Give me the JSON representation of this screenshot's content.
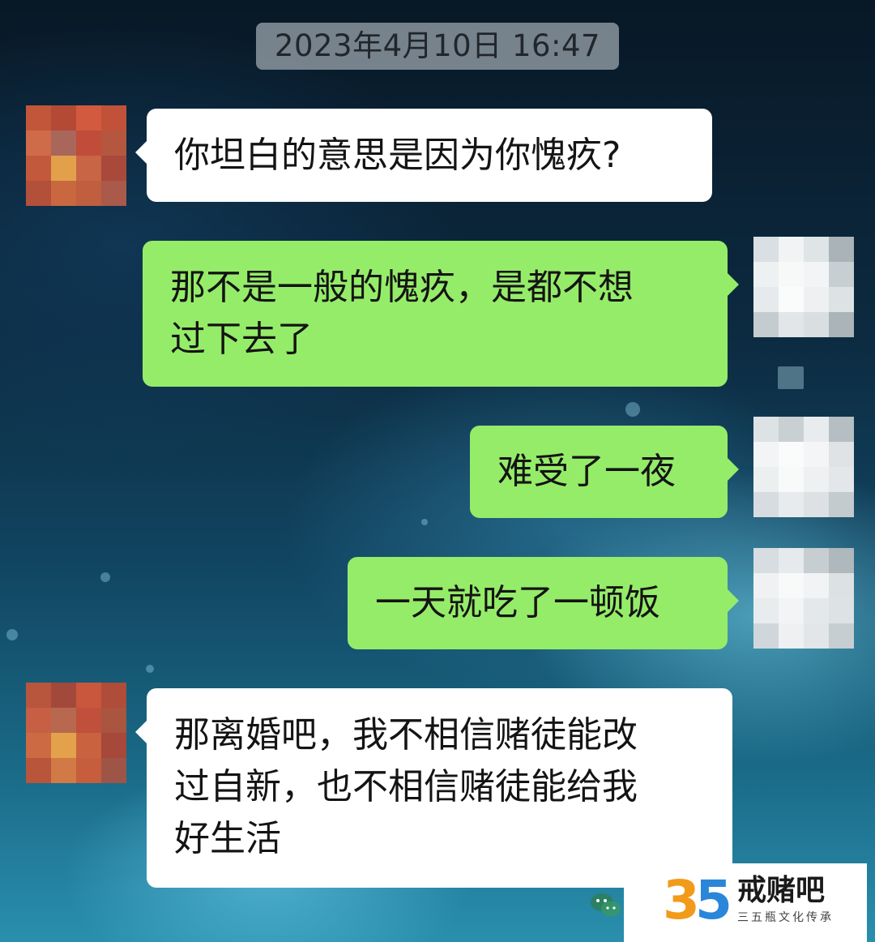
{
  "chat": {
    "timestamp": "2023年4月10日 16:47",
    "messages": [
      {
        "side": "left",
        "lines": [
          "你坦白的意思是因为你愧疚?"
        ]
      },
      {
        "side": "right",
        "lines": [
          "那不是一般的愧疚，是都不想",
          "过下去了"
        ]
      },
      {
        "side": "right",
        "lines": [
          "难受了一夜"
        ]
      },
      {
        "side": "right",
        "lines": [
          "一天就吃了一顿饭"
        ]
      },
      {
        "side": "left",
        "lines": [
          "那离婚吧，我不相信赌徒能改",
          "过自新，也不相信赌徒能给我",
          "好生活"
        ]
      }
    ]
  },
  "watermark": {
    "number_first": "3",
    "number_second": "5",
    "title": "戒赌吧",
    "subtitle": "三五瓶文化传承"
  },
  "colors": {
    "left_bubble": "#ffffff",
    "right_bubble": "#95ec69",
    "timestamp_bg": "#969fa8"
  },
  "icons": {
    "wechat": "wechat-icon"
  }
}
